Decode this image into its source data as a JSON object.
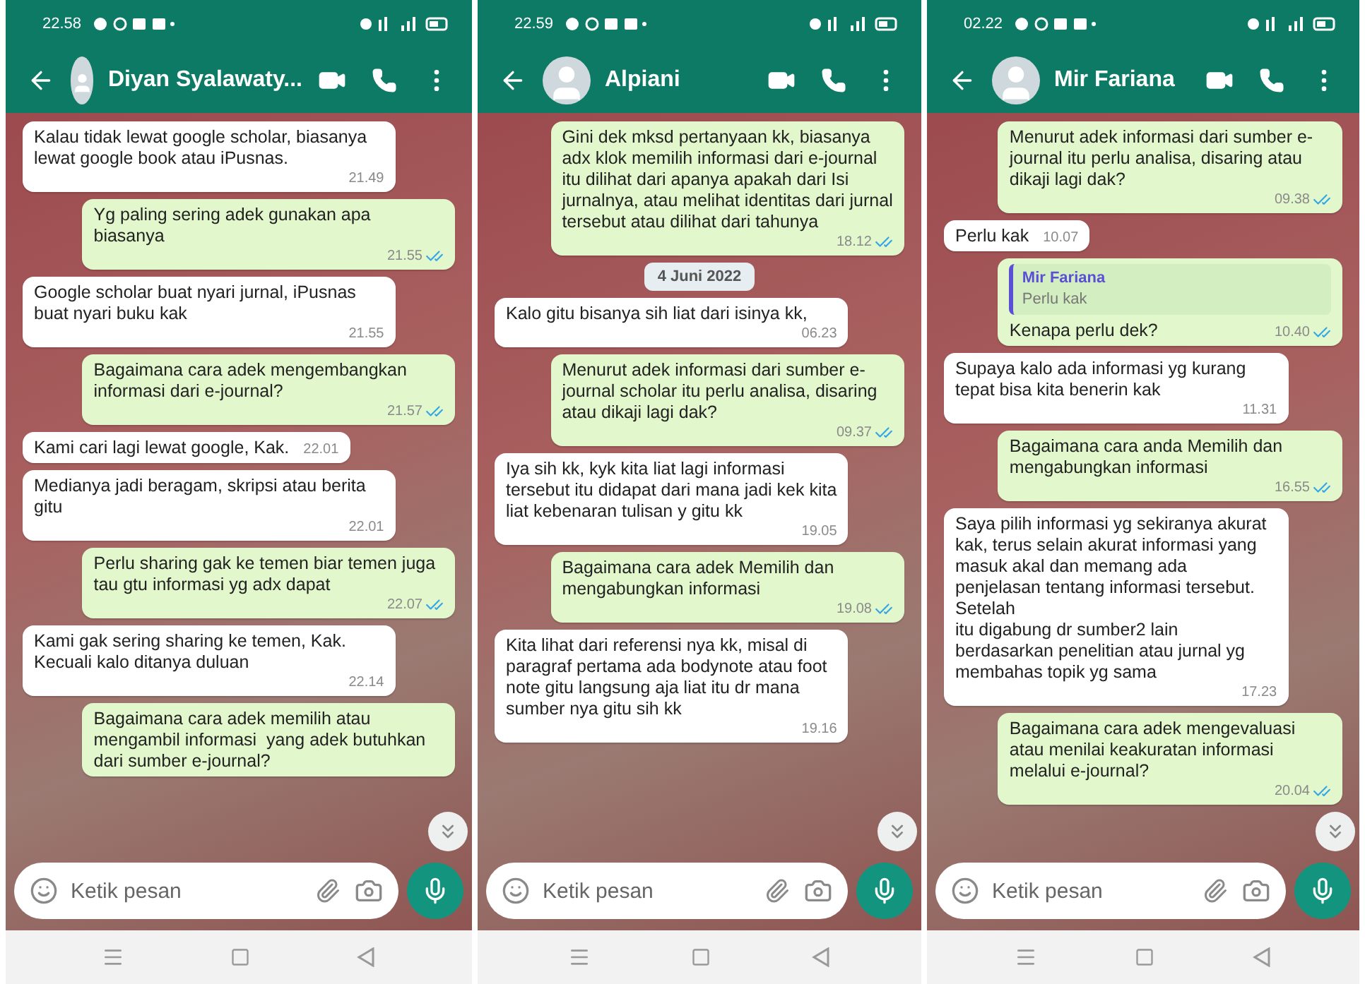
{
  "panels": [
    {
      "status_time": "22.58",
      "contact": {
        "name": "Diyan Syalawaty..."
      },
      "messages": [
        {
          "kind": "in",
          "text": "Kalau tidak lewat google scholar, biasanya lewat google book atau iPusnas.",
          "time": "21.49"
        },
        {
          "kind": "out",
          "text": "Yg paling sering adek gunakan apa biasanya",
          "time": "21.55",
          "read": true
        },
        {
          "kind": "in",
          "text": "Google scholar buat nyari jurnal, iPusnas buat nyari buku kak",
          "time": "21.55"
        },
        {
          "kind": "out",
          "text": "Bagaimana cara adek mengembangkan informasi dari e-journal?",
          "time": "21.57",
          "read": true
        },
        {
          "kind": "in",
          "text": "Kami cari lagi lewat google, Kak.",
          "time": "22.01"
        },
        {
          "kind": "in",
          "text": "Medianya jadi beragam, skripsi atau berita gitu",
          "time": "22.01"
        },
        {
          "kind": "out",
          "text": "Perlu sharing gak ke temen biar temen juga tau gtu informasi yg adx dapat",
          "time": "22.07",
          "read": true
        },
        {
          "kind": "in",
          "text": "Kami gak sering sharing ke temen, Kak. Kecuali kalo ditanya duluan",
          "time": "22.14"
        },
        {
          "kind": "out",
          "text": "Bagaimana cara adek memilih atau mengambil informasi  yang adek butuhkan dari sumber e-journal?"
        }
      ],
      "input": {
        "placeholder": "Ketik pesan"
      }
    },
    {
      "status_time": "22.59",
      "contact": {
        "name": "Alpiani"
      },
      "messages": [
        {
          "kind": "out",
          "text": "Gini dek mksd pertanyaan kk, biasanya adx klok memilih informasi dari e-journal itu dilihat dari apanya apakah dari Isi jurnalnya, atau melihat identitas dari jurnal tersebut atau dilihat dari tahunya",
          "time": "18.12",
          "read": true
        },
        {
          "kind": "date",
          "text": "4 Juni 2022"
        },
        {
          "kind": "in",
          "text": "Kalo gitu bisanya sih liat dari isinya kk,",
          "time": "06.23"
        },
        {
          "kind": "out",
          "text": "Menurut adek informasi dari sumber e-journal scholar itu perlu analisa, disaring atau dikaji lagi dak?",
          "time": "09.37",
          "read": true
        },
        {
          "kind": "in",
          "text": "Iya sih kk, kyk kita liat lagi informasi tersebut itu didapat dari mana jadi kek kita liat kebenaran tulisan y gitu kk",
          "time": "19.05"
        },
        {
          "kind": "out",
          "text": "Bagaimana cara adek Memilih dan mengabungkan informasi",
          "time": "19.08",
          "read": true
        },
        {
          "kind": "in",
          "text": "Kita lihat dari referensi nya kk, misal di paragraf pertama ada bodynote atau foot note gitu langsung aja liat itu dr mana sumber nya gitu sih kk",
          "time": "19.16"
        }
      ],
      "input": {
        "placeholder": "Ketik pesan"
      }
    },
    {
      "status_time": "02.22",
      "contact": {
        "name": "Mir Fariana"
      },
      "messages": [
        {
          "kind": "out",
          "text": "Menurut adek informasi dari sumber e-journal itu perlu analisa, disaring atau dikaji lagi dak?",
          "time": "09.38",
          "read": true
        },
        {
          "kind": "in",
          "text": "Perlu kak",
          "time": "10.07"
        },
        {
          "kind": "reply",
          "quote_name": "Mir Fariana",
          "quote_text": "Perlu kak",
          "text": "Kenapa perlu dek?",
          "time": "10.40",
          "read": true
        },
        {
          "kind": "in",
          "text": "Supaya kalo ada informasi yg kurang tepat bisa kita benerin kak",
          "time": "11.31"
        },
        {
          "kind": "out",
          "text": "Bagaimana cara anda Memilih dan mengabungkan informasi",
          "time": "16.55",
          "read": true
        },
        {
          "kind": "in",
          "text": "Saya pilih informasi yg sekiranya akurat kak, terus selain akurat informasi yang  masuk akal dan memang ada penjelasan tentang informasi tersebut. Setelah\nitu digabung dr sumber2 lain berdasarkan penelitian atau jurnal yg membahas topik yg sama",
          "time": "17.23"
        },
        {
          "kind": "out",
          "text": "Bagaimana cara adek mengevaluasi atau menilai keakuratan informasi melalui e-journal?",
          "time": "20.04",
          "read": true
        }
      ],
      "input": {
        "placeholder": "Ketik pesan"
      }
    }
  ]
}
